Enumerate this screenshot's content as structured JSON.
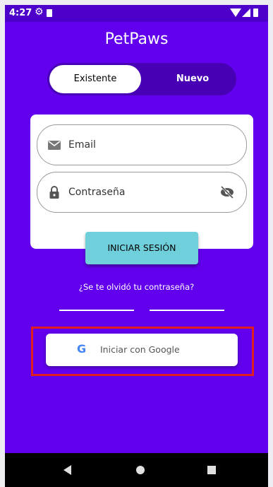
{
  "status_bar": {
    "time": "4:27"
  },
  "app": {
    "title": "PetPaws"
  },
  "toggle": {
    "existing_label": "Existente",
    "new_label": "Nuevo"
  },
  "login_form": {
    "email_placeholder": "Email",
    "password_placeholder": "Contraseña",
    "login_button": "INICIAR SESIÓN"
  },
  "forgot_password": "¿Se te olvidó tu contraseña?",
  "google_signin": {
    "label": "Iniciar con Google",
    "icon_letter": "G"
  },
  "colors": {
    "background": "#6200ee",
    "status_bar": "#4d00c9",
    "toggle_bg": "#4700b4",
    "login_button": "#6fd0db",
    "highlight_border": "#e01e1e",
    "google_blue": "#4285f4"
  },
  "icons": [
    "gear-icon",
    "sd-card-icon",
    "wifi-icon",
    "cell-signal-icon",
    "battery-icon",
    "mail-icon",
    "lock-icon",
    "eye-off-icon",
    "google-icon",
    "back-icon",
    "home-icon",
    "recents-icon"
  ]
}
